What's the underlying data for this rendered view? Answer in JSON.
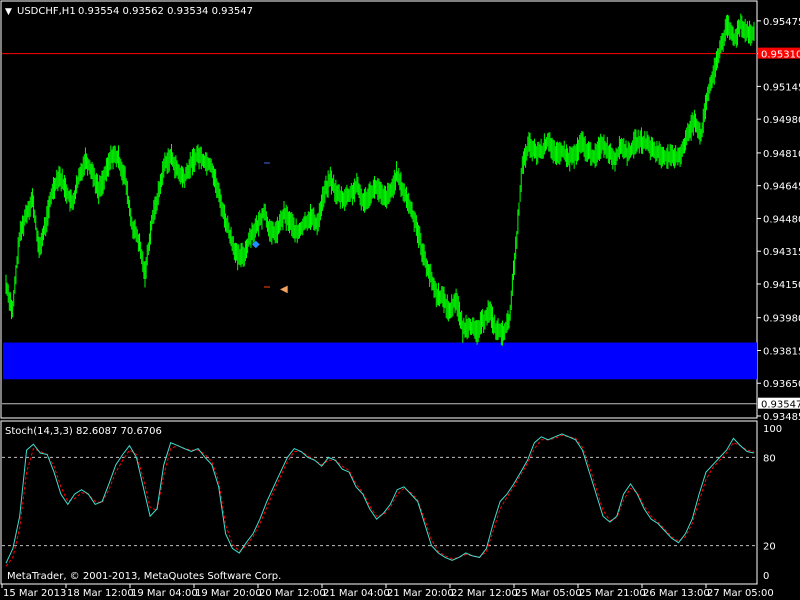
{
  "header": {
    "symbol_label": "USDCHF,H1",
    "ohlc_values": "0.93554 0.93562 0.93534 0.93547"
  },
  "price_axis": {
    "ticks": [
      "0.95475",
      "0.95310",
      "0.95145",
      "0.94980",
      "0.94810",
      "0.94645",
      "0.94480",
      "0.94315",
      "0.94150",
      "0.93980",
      "0.93815",
      "0.93650",
      "0.93547",
      "0.93485"
    ],
    "current_price": "0.93547",
    "red_line_price": "0.95310"
  },
  "indicator": {
    "label": "Stoch(14,3,3) 82.6087 70.6706",
    "levels": [
      "100",
      "80",
      "20",
      "0"
    ]
  },
  "copyright": "MetaTrader, © 2001-2013, MetaQuotes Software Corp.",
  "time_axis": {
    "labels": [
      "15 Mar 2013",
      "18 Mar 12:00",
      "19 Mar 04:00",
      "19 Mar 20:00",
      "20 Mar 12:00",
      "21 Mar 04:00",
      "21 Mar 20:00",
      "22 Mar 12:00",
      "25 Mar 05:00",
      "25 Mar 21:00",
      "26 Mar 13:00",
      "27 Mar 05:00"
    ]
  },
  "colors": {
    "background": "#000000",
    "bars": "#00ff00",
    "blue_zone": "#0000ff",
    "red_line": "#ff0000",
    "stoch_main": "#40e0d0",
    "stoch_signal": "#ff0000"
  },
  "chart_data": {
    "type": "candlestick",
    "symbol": "USDCHF",
    "timeframe": "H1",
    "price_range": [
      0.93485,
      0.9556
    ],
    "closes": [
      0.9415,
      0.9401,
      0.9438,
      0.945,
      0.9458,
      0.9432,
      0.9445,
      0.9462,
      0.947,
      0.9463,
      0.9455,
      0.9468,
      0.9478,
      0.9472,
      0.9462,
      0.947,
      0.948,
      0.9478,
      0.9468,
      0.9445,
      0.9437,
      0.942,
      0.9446,
      0.946,
      0.9476,
      0.9479,
      0.9471,
      0.9468,
      0.9476,
      0.948,
      0.9477,
      0.9475,
      0.9462,
      0.9449,
      0.9438,
      0.9428,
      0.943,
      0.944,
      0.9444,
      0.9452,
      0.944,
      0.9442,
      0.945,
      0.9446,
      0.944,
      0.9445,
      0.9449,
      0.9445,
      0.946,
      0.9468,
      0.946,
      0.9458,
      0.946,
      0.9464,
      0.9456,
      0.9461,
      0.9464,
      0.9458,
      0.946,
      0.947,
      0.9462,
      0.9454,
      0.9445,
      0.943,
      0.942,
      0.941,
      0.9408,
      0.9401,
      0.9408,
      0.9392,
      0.9395,
      0.939,
      0.9396,
      0.9402,
      0.9392,
      0.939,
      0.9396,
      0.9432,
      0.9474,
      0.9485,
      0.9481,
      0.9482,
      0.9488,
      0.9479,
      0.9482,
      0.9478,
      0.948,
      0.9486,
      0.9481,
      0.9479,
      0.9486,
      0.9482,
      0.9478,
      0.9485,
      0.948,
      0.9486,
      0.9487,
      0.9485,
      0.9482,
      0.948,
      0.9479,
      0.9478,
      0.9481,
      0.949,
      0.9498,
      0.949,
      0.951,
      0.9522,
      0.9535,
      0.9545,
      0.9538,
      0.9546,
      0.9542,
      0.954
    ],
    "current_price": 0.93547,
    "red_line_price": 0.9531,
    "zone": {
      "price_low": 0.9367,
      "price_high": 0.93855
    },
    "stochastic": {
      "params": "14,3,3",
      "main": 82.6087,
      "signal": 70.6706,
      "levels": [
        80,
        20
      ],
      "range": [
        0,
        100
      ],
      "main_series": [
        8,
        18,
        40,
        85,
        89,
        83,
        82,
        70,
        55,
        48,
        55,
        58,
        55,
        48,
        50,
        62,
        75,
        82,
        88,
        80,
        60,
        40,
        45,
        75,
        90,
        88,
        86,
        84,
        86,
        80,
        75,
        60,
        28,
        18,
        15,
        22,
        28,
        38,
        50,
        60,
        70,
        80,
        86,
        84,
        80,
        78,
        74,
        80,
        78,
        72,
        70,
        60,
        55,
        45,
        38,
        42,
        48,
        58,
        60,
        55,
        50,
        35,
        20,
        15,
        12,
        10,
        12,
        15,
        13,
        12,
        18,
        35,
        50,
        55,
        62,
        70,
        78,
        90,
        94,
        92,
        94,
        96,
        94,
        92,
        85,
        70,
        55,
        40,
        36,
        40,
        55,
        62,
        55,
        45,
        38,
        35,
        30,
        25,
        22,
        28,
        38,
        55,
        70,
        75,
        80,
        85,
        93,
        88,
        84,
        83
      ],
      "signal_series": [
        6,
        12,
        32,
        70,
        86,
        84,
        82,
        74,
        60,
        50,
        52,
        56,
        55,
        50,
        49,
        58,
        70,
        78,
        85,
        82,
        66,
        46,
        44,
        68,
        86,
        88,
        86,
        85,
        85,
        82,
        77,
        64,
        34,
        21,
        16,
        20,
        26,
        35,
        46,
        57,
        67,
        77,
        84,
        84,
        81,
        78,
        75,
        78,
        78,
        74,
        71,
        62,
        56,
        47,
        40,
        41,
        46,
        55,
        59,
        56,
        51,
        38,
        24,
        16,
        13,
        11,
        12,
        14,
        13,
        12,
        16,
        30,
        45,
        53,
        60,
        68,
        76,
        86,
        92,
        92,
        93,
        95,
        94,
        93,
        87,
        74,
        59,
        44,
        37,
        39,
        51,
        59,
        56,
        47,
        40,
        36,
        31,
        26,
        23,
        26,
        35,
        50,
        65,
        73,
        78,
        83,
        90,
        88,
        85,
        84
      ]
    },
    "time_labels": [
      "15 Mar 2013",
      "18 Mar 12:00",
      "19 Mar 04:00",
      "19 Mar 20:00",
      "20 Mar 12:00",
      "21 Mar 04:00",
      "21 Mar 20:00",
      "22 Mar 12:00",
      "25 Mar 05:00",
      "25 Mar 21:00",
      "26 Mar 13:00",
      "27 Mar 05:00"
    ]
  }
}
